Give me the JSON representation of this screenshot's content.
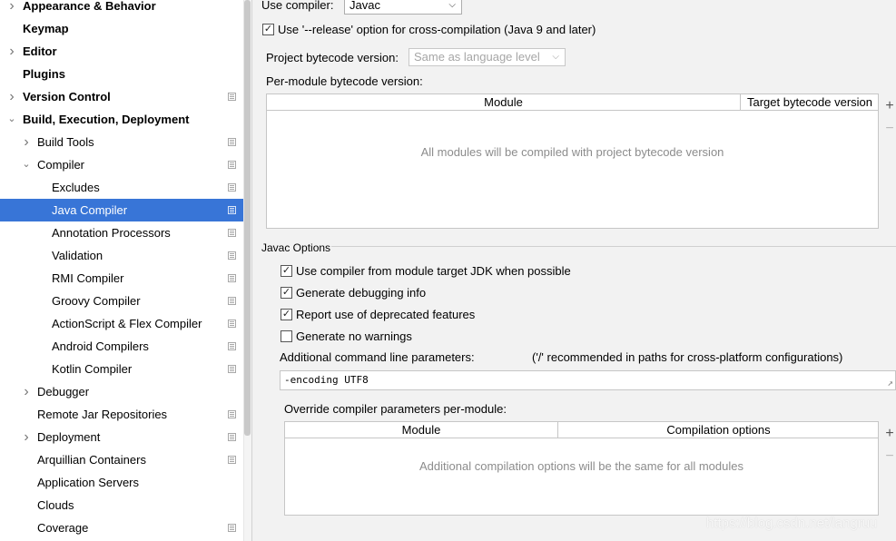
{
  "sidebar": {
    "items": [
      {
        "label": "Appearance & Behavior",
        "bold": true,
        "arrow": "right",
        "project_icon": false,
        "selected": false
      },
      {
        "label": "Keymap",
        "bold": true,
        "arrow": null,
        "project_icon": false,
        "selected": false
      },
      {
        "label": "Editor",
        "bold": true,
        "arrow": "right",
        "project_icon": false,
        "selected": false
      },
      {
        "label": "Plugins",
        "bold": true,
        "arrow": null,
        "project_icon": false,
        "selected": false
      },
      {
        "label": "Version Control",
        "bold": true,
        "arrow": "right",
        "project_icon": true,
        "selected": false
      },
      {
        "label": "Build, Execution, Deployment",
        "bold": true,
        "arrow": "down",
        "project_icon": false,
        "selected": false
      },
      {
        "label": "Build Tools",
        "bold": false,
        "arrow": "right",
        "project_icon": true,
        "selected": false
      },
      {
        "label": "Compiler",
        "bold": false,
        "arrow": "down",
        "project_icon": true,
        "selected": false
      },
      {
        "label": "Excludes",
        "bold": false,
        "arrow": null,
        "project_icon": true,
        "selected": false
      },
      {
        "label": "Java Compiler",
        "bold": false,
        "arrow": null,
        "project_icon": true,
        "selected": true
      },
      {
        "label": "Annotation Processors",
        "bold": false,
        "arrow": null,
        "project_icon": true,
        "selected": false
      },
      {
        "label": "Validation",
        "bold": false,
        "arrow": null,
        "project_icon": true,
        "selected": false
      },
      {
        "label": "RMI Compiler",
        "bold": false,
        "arrow": null,
        "project_icon": true,
        "selected": false
      },
      {
        "label": "Groovy Compiler",
        "bold": false,
        "arrow": null,
        "project_icon": true,
        "selected": false
      },
      {
        "label": "ActionScript & Flex Compiler",
        "bold": false,
        "arrow": null,
        "project_icon": true,
        "selected": false
      },
      {
        "label": "Android Compilers",
        "bold": false,
        "arrow": null,
        "project_icon": true,
        "selected": false
      },
      {
        "label": "Kotlin Compiler",
        "bold": false,
        "arrow": null,
        "project_icon": true,
        "selected": false
      },
      {
        "label": "Debugger",
        "bold": false,
        "arrow": "right",
        "project_icon": false,
        "selected": false
      },
      {
        "label": "Remote Jar Repositories",
        "bold": false,
        "arrow": null,
        "project_icon": true,
        "selected": false
      },
      {
        "label": "Deployment",
        "bold": false,
        "arrow": "right",
        "project_icon": true,
        "selected": false
      },
      {
        "label": "Arquillian Containers",
        "bold": false,
        "arrow": null,
        "project_icon": true,
        "selected": false
      },
      {
        "label": "Application Servers",
        "bold": false,
        "arrow": null,
        "project_icon": false,
        "selected": false
      },
      {
        "label": "Clouds",
        "bold": false,
        "arrow": null,
        "project_icon": false,
        "selected": false
      },
      {
        "label": "Coverage",
        "bold": false,
        "arrow": null,
        "project_icon": true,
        "selected": false
      }
    ]
  },
  "main": {
    "use_compiler_label": "Use compiler:",
    "use_compiler_value": "Javac",
    "release_option_label": "Use '--release' option for cross-compilation (Java 9 and later)",
    "release_option_checked": true,
    "bytecode_version_label": "Project bytecode version:",
    "bytecode_version_value": "Same as language level",
    "per_module_label": "Per-module bytecode version:",
    "per_module_table": {
      "col_module": "Module",
      "col_target": "Target bytecode version",
      "empty_text": "All modules will be compiled with project bytecode version"
    },
    "javac_section_title": "Javac Options",
    "javac_options": [
      {
        "label": "Use compiler from module target JDK when possible",
        "checked": true
      },
      {
        "label": "Generate debugging info",
        "checked": true
      },
      {
        "label": "Report use of deprecated features",
        "checked": true
      },
      {
        "label": "Generate no warnings",
        "checked": false
      }
    ],
    "additional_params_label": "Additional command line parameters:",
    "additional_params_hint": "('/' recommended in paths for cross-platform configurations)",
    "additional_params_value": "-encoding UTF8",
    "override_label": "Override compiler parameters per-module:",
    "override_table": {
      "col_module": "Module",
      "col_options": "Compilation options",
      "empty_text": "Additional compilation options will be the same for all modules"
    },
    "add_symbol": "+",
    "remove_symbol": "−"
  },
  "watermark": "https://blog.csdn.net/langruu",
  "colors": {
    "selection": "#3875d7",
    "background": "#f2f2f2",
    "empty_text": "#8c8c8c"
  }
}
